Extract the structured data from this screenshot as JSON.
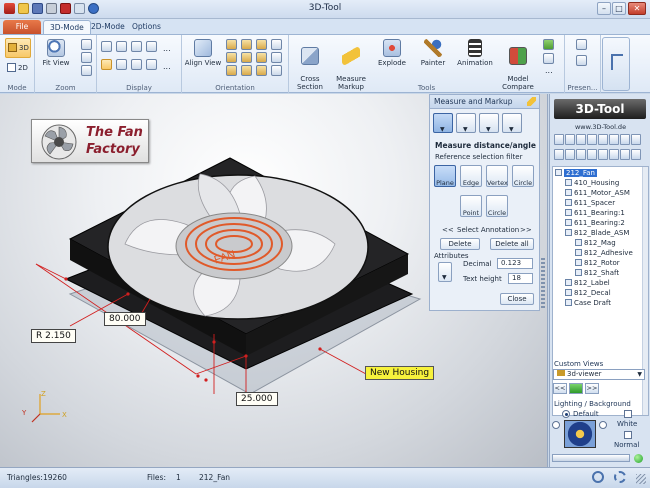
{
  "window": {
    "title": "3D-Tool",
    "minimize": "–",
    "maximize": "□",
    "close": "✕"
  },
  "tabs": [
    {
      "label": "File"
    },
    {
      "label": "3D-Mode"
    },
    {
      "label": "2D-Mode"
    },
    {
      "label": "Options"
    }
  ],
  "ribbon": {
    "groups": {
      "mode": "Mode",
      "zoom": "Zoom",
      "display": "Display",
      "orientation": "Orientation",
      "tools": "Tools",
      "presentation": "Presen..."
    },
    "mode_3d": "3D",
    "mode_2d": "2D",
    "fit_view": "Fit View",
    "align_view": "Align View",
    "cross_section": "Cross\nSection",
    "measure_markup": "Measure\nMarkup",
    "explode": "Explode",
    "painter": "Painter",
    "animation": "Animation",
    "model_compare": "Model\nCompare",
    "dots": "..."
  },
  "viewport": {
    "logo_line1": "The Fan",
    "logo_line2": "Factory",
    "fan_label": "FAN",
    "dim_radius": "R 2.150",
    "dim_width": "80.000",
    "dim_depth": "25.000",
    "callout": "New Housing",
    "axis_x": "X",
    "axis_y": "Y",
    "axis_z": "Z"
  },
  "measure": {
    "header": "Measure and Markup",
    "title": "Measure distance/angle",
    "filter_label": "Reference selection filter",
    "filters": [
      "Plane",
      "Edge",
      "Vertex",
      "Circle"
    ],
    "points": [
      "Point",
      "Circle"
    ],
    "prev": "<<",
    "select_annotation": "Select Annotation",
    "next": ">>",
    "delete": "Delete",
    "delete_all": "Delete all",
    "attributes": "Attributes",
    "decimal_label": "Decimal",
    "decimal_value": "0.123",
    "text_height_label": "Text height",
    "text_height_value": "18",
    "close": "Close"
  },
  "sidepanel": {
    "brand": "3D-Tool",
    "url": "www.3D-Tool.de",
    "tree": [
      {
        "label": "212_Fan",
        "level": 0,
        "selected": true
      },
      {
        "label": "410_Housing",
        "level": 1
      },
      {
        "label": "611_Motor_ASM",
        "level": 1
      },
      {
        "label": "611_Spacer",
        "level": 1
      },
      {
        "label": "611_Bearing:1",
        "level": 1
      },
      {
        "label": "611_Bearing:2",
        "level": 1
      },
      {
        "label": "812_Blade_ASM",
        "level": 1
      },
      {
        "label": "812_Mag",
        "level": 2
      },
      {
        "label": "812_Adhesive",
        "level": 2
      },
      {
        "label": "812_Rotor",
        "level": 2
      },
      {
        "label": "812_Shaft",
        "level": 2
      },
      {
        "label": "812_Label",
        "level": 1
      },
      {
        "label": "812_Decal",
        "level": 1
      },
      {
        "label": "Case Draft",
        "level": 1
      }
    ],
    "custom_views_label": "Custom Views",
    "custom_view_value": "3d-viewer",
    "view_prev": "<<",
    "view_next": ">>",
    "lighting_label": "Lighting / Background",
    "default_label": "Default",
    "white_label": "White",
    "normal_label": "Normal"
  },
  "status": {
    "triangles_label": "Triangles:",
    "triangles_value": "19260",
    "files_label": "Files:",
    "files_value": "1",
    "file_name": "212_Fan"
  }
}
